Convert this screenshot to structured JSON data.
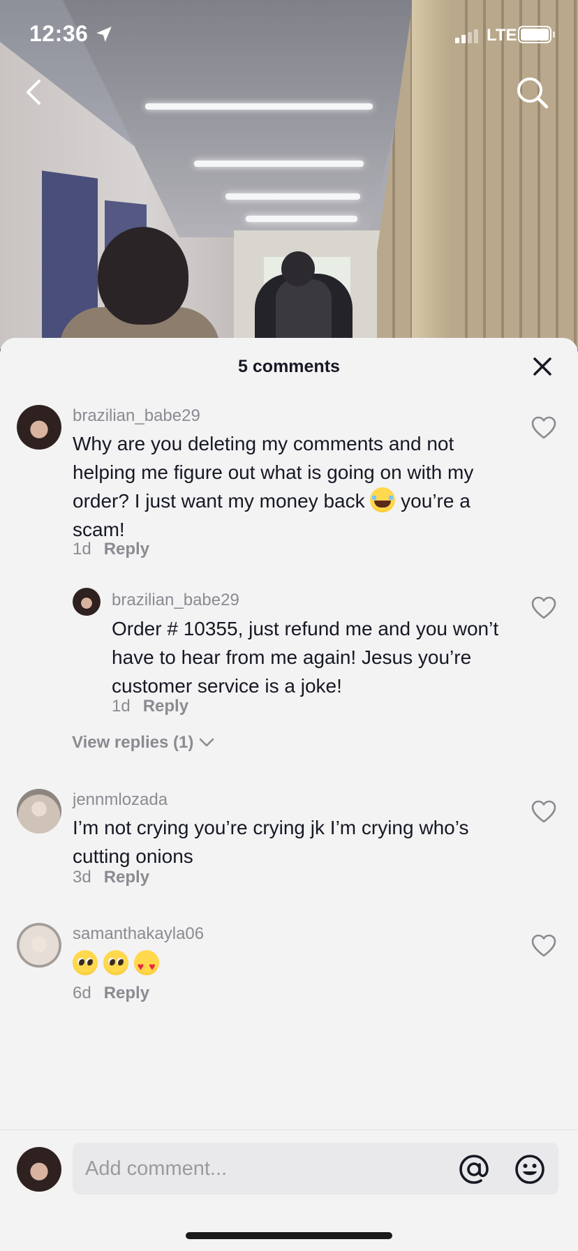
{
  "status_bar": {
    "time": "12:36",
    "network": "LTE"
  },
  "sheet": {
    "title": "5 comments"
  },
  "comments": [
    {
      "username": "brazilian_babe29",
      "text_before": "Why are you deleting my comments and not helping me figure out what is going on with my order? I just want my money back ",
      "text_after": " you’re a scam!",
      "emoji": "loudly-crying-face",
      "time": "1d",
      "reply_label": "Reply",
      "replies": [
        {
          "username": "brazilian_babe29",
          "text": "Order # 10355, just refund me and you won’t have to hear from me again! Jesus you’re customer service is a joke!",
          "time": "1d",
          "reply_label": "Reply"
        }
      ],
      "view_replies_label": "View replies (1)"
    },
    {
      "username": "jennmlozada",
      "text": "I’m not crying you’re crying jk I’m crying who’s cutting onions",
      "time": "3d",
      "reply_label": "Reply"
    },
    {
      "username": "samanthakayla06",
      "emojis": [
        "pleading-face",
        "pleading-face",
        "smiling-face-with-heart-eyes"
      ],
      "time": "6d",
      "reply_label": "Reply"
    }
  ],
  "composer": {
    "placeholder": "Add comment..."
  },
  "icons": {
    "navigation": [
      "back-icon",
      "search-icon",
      "close-icon",
      "location-arrow-icon"
    ],
    "composer": [
      "at-icon",
      "emoji-icon"
    ],
    "like": "heart-icon"
  },
  "colors": {
    "sheet_bg": "#f3f3f4",
    "text_primary": "#161823",
    "text_secondary": "#8a8b91"
  }
}
